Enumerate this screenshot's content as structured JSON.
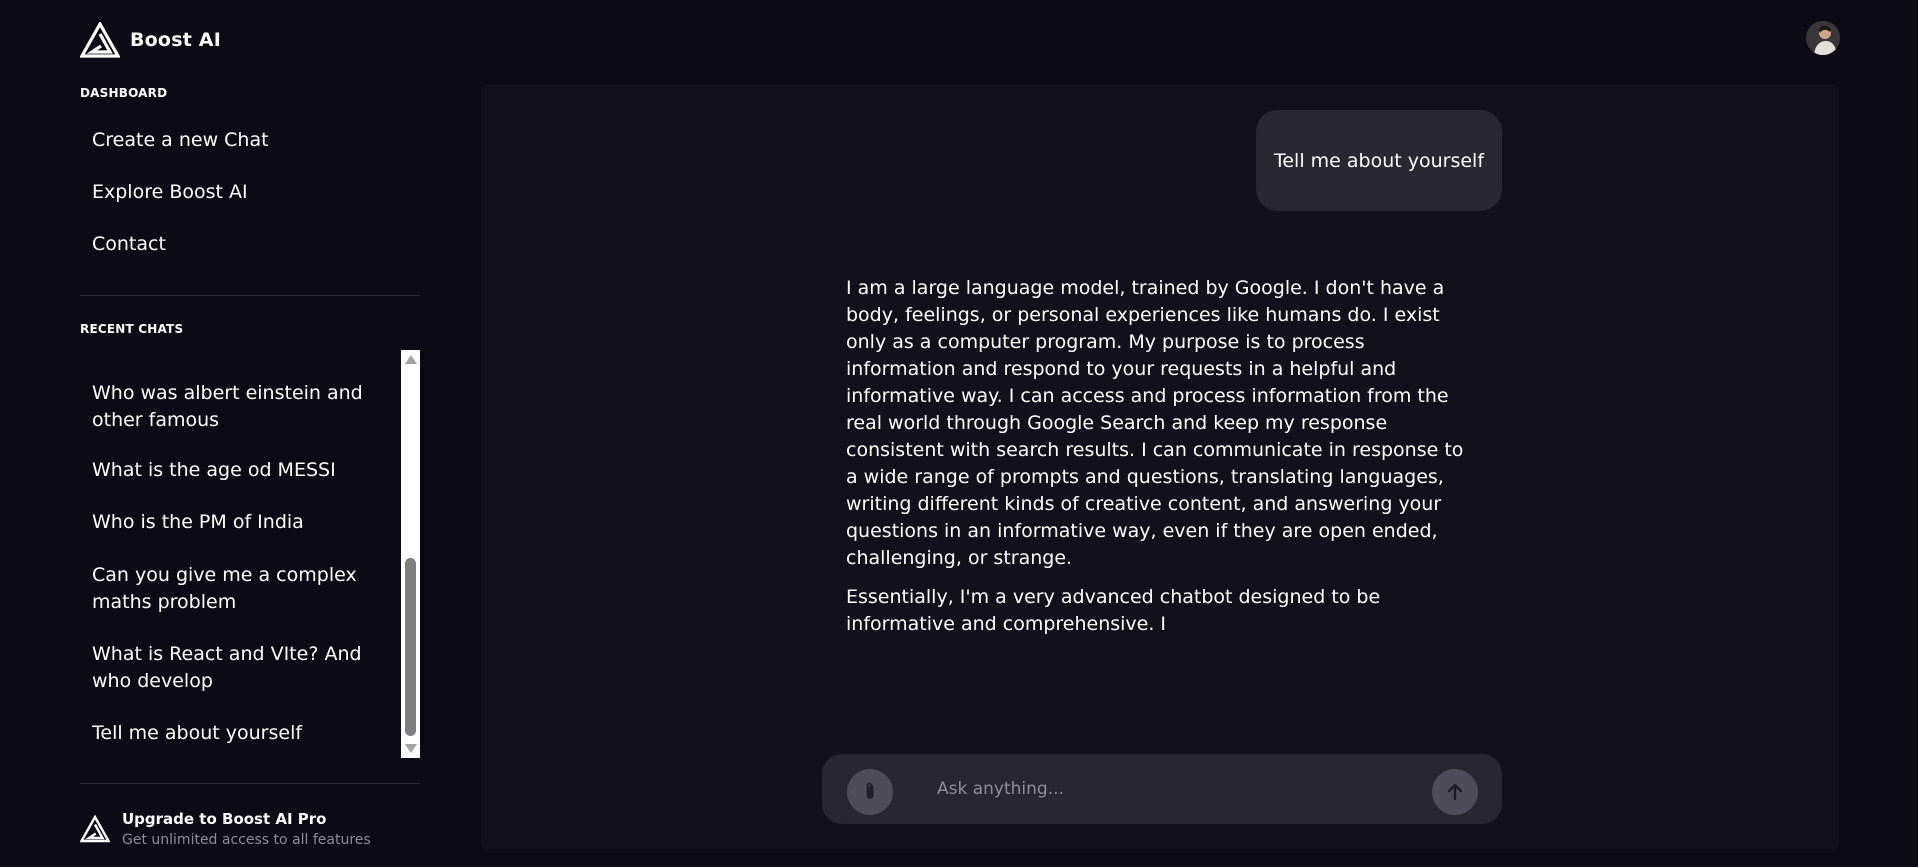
{
  "app": {
    "name": "Boost AI"
  },
  "sidebar": {
    "dashboard_label": "DASHBOARD",
    "nav_items": [
      {
        "label": "Create a new Chat"
      },
      {
        "label": "Explore Boost AI"
      },
      {
        "label": "Contact"
      }
    ],
    "recent_label": "RECENT CHATS",
    "recent_chats": [
      {
        "label": "Who was albert einstein and other famous"
      },
      {
        "label": "What is the age od MESSI"
      },
      {
        "label": "Who is the PM of India"
      },
      {
        "label": "Can you give me a complex maths problem"
      },
      {
        "label": "What is React and VIte? And who develop"
      },
      {
        "label": "Tell me about yourself"
      }
    ],
    "upgrade": {
      "title": "Upgrade to Boost AI Pro",
      "subtitle": "Get unlimited access to all features"
    }
  },
  "chat": {
    "user_message": "Tell me about yourself",
    "ai_response": [
      "I am a large language model, trained by Google. I don't have a body, feelings, or personal experiences like humans do. I exist only as a computer program. My purpose is to process information and respond to your requests in a helpful and informative way. I can access and process information from the real world through Google Search and keep my response consistent with search results. I can communicate in response to a wide range of prompts and questions, translating languages, writing different kinds of creative content, and answering your questions in an informative way, even if they are open ended, challenging, or strange.",
      "Essentially, I'm a very advanced chatbot designed to be informative and comprehensive. I"
    ]
  },
  "input": {
    "placeholder": "Ask anything..."
  },
  "colors": {
    "background": "#0c0b15",
    "panel": "#11101b",
    "bubble": "#282732",
    "input_bar": "#272631",
    "round_button": "#4d4c58"
  },
  "icons": {
    "logo": "boost-logo-icon",
    "avatar": "user-avatar",
    "attach": "paperclip-icon",
    "send": "arrow-up-icon"
  }
}
